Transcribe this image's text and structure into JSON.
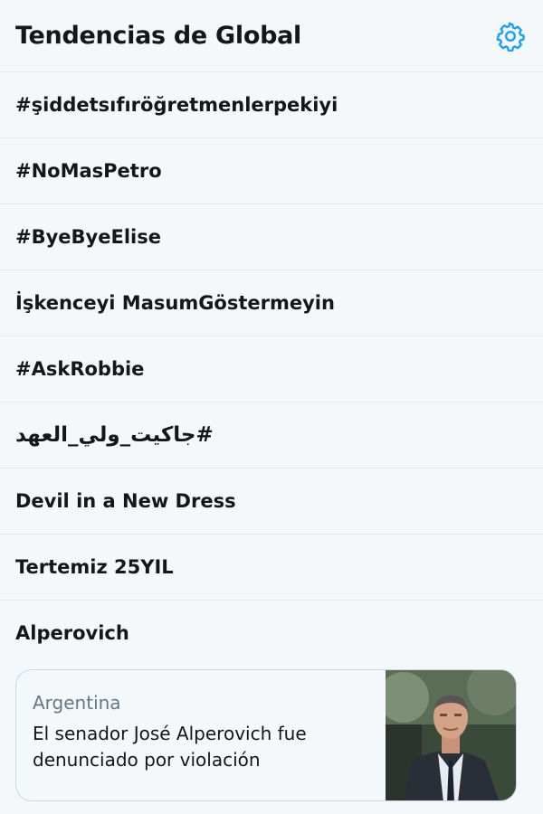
{
  "header": {
    "title": "Tendencias de Global",
    "settings_icon": "gear-icon",
    "accent_color": "#1da1f2"
  },
  "trends": [
    {
      "label": "#şiddetsıfıröğretmenlerpekiyi"
    },
    {
      "label": "#NoMasPetro"
    },
    {
      "label": "#ByeByeElise"
    },
    {
      "label": "İşkenceyi MasumGöstermeyin"
    },
    {
      "label": "#AskRobbie"
    },
    {
      "label": "#جاكيت_ولي_العهد"
    },
    {
      "label": "Devil in a New Dress"
    },
    {
      "label": "Tertemiz 25YIL"
    },
    {
      "label": "Alperovich"
    }
  ],
  "card": {
    "source": "Argentina",
    "headline": "El senador José Alperovich fue denunciado por violación"
  }
}
